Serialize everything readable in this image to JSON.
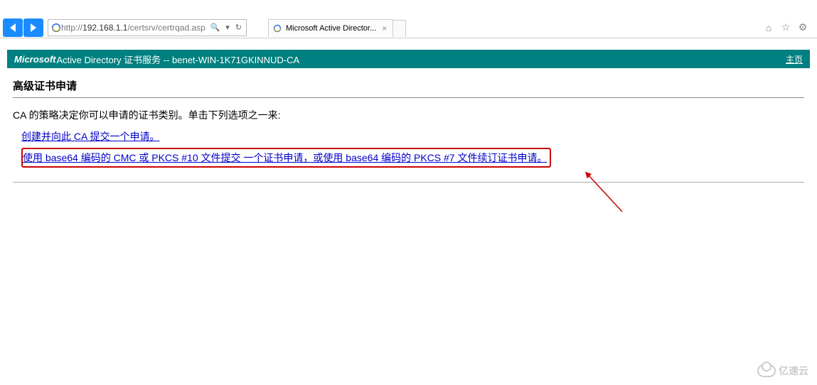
{
  "window": {
    "controls": {
      "minimize": "—",
      "maximize": "▢"
    }
  },
  "nav": {
    "url_prefix": "http://",
    "url_host": "192.168.1.1",
    "url_path": "/certsrv/certrqad.asp",
    "search_icon": "🔍",
    "dropdown_icon": "▾",
    "refresh_icon": "↻"
  },
  "tab": {
    "title": "Microsoft Active Director...",
    "close": "×"
  },
  "toolbar": {
    "home": "⌂",
    "fav": "☆",
    "gear": "⚙"
  },
  "banner": {
    "brand": "Microsoft",
    "suffix": " Active Directory 证书服务  --  benet-WIN-1K71GKINNUD-CA",
    "home_link": "主页"
  },
  "page": {
    "title": "高级证书申请",
    "intro": "CA 的策略决定你可以申请的证书类别。单击下列选项之一来:",
    "link1": "创建并向此 CA 提交一个申请。",
    "link2": "使用 base64 编码的 CMC 或 PKCS #10 文件提交 一个证书申请，或使用 base64 编码的 PKCS #7 文件续订证书申请。"
  },
  "watermark": {
    "text": "亿速云"
  }
}
